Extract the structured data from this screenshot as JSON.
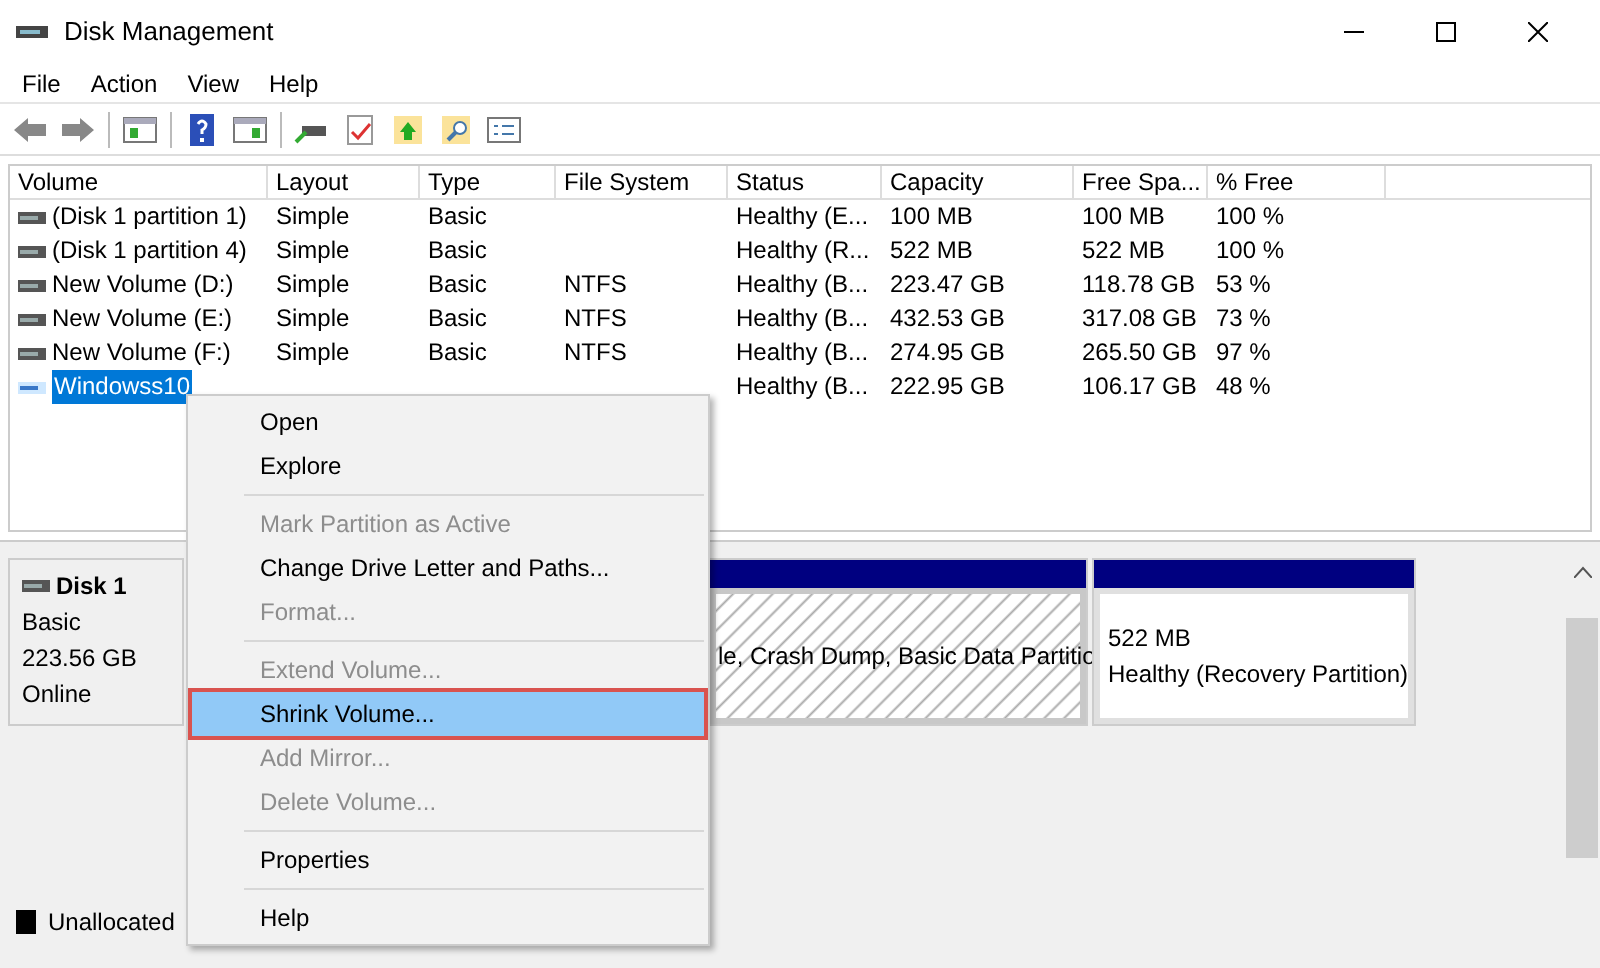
{
  "window": {
    "title": "Disk Management"
  },
  "menu": [
    "File",
    "Action",
    "View",
    "Help"
  ],
  "table": {
    "columns": [
      "Volume",
      "Layout",
      "Type",
      "File System",
      "Status",
      "Capacity",
      "Free Spa...",
      "% Free"
    ],
    "rows": [
      {
        "selected": false,
        "cells": [
          "(Disk 1 partition 1)",
          "Simple",
          "Basic",
          "",
          "Healthy (E...",
          "100 MB",
          "100 MB",
          "100 %"
        ]
      },
      {
        "selected": false,
        "cells": [
          "(Disk 1 partition 4)",
          "Simple",
          "Basic",
          "",
          "Healthy (R...",
          "522 MB",
          "522 MB",
          "100 %"
        ]
      },
      {
        "selected": false,
        "cells": [
          "New Volume (D:)",
          "Simple",
          "Basic",
          "NTFS",
          "Healthy (B...",
          "223.47 GB",
          "118.78 GB",
          "53 %"
        ]
      },
      {
        "selected": false,
        "cells": [
          "New Volume (E:)",
          "Simple",
          "Basic",
          "NTFS",
          "Healthy (B...",
          "432.53 GB",
          "317.08 GB",
          "73 %"
        ]
      },
      {
        "selected": false,
        "cells": [
          "New Volume (F:)",
          "Simple",
          "Basic",
          "NTFS",
          "Healthy (B...",
          "274.95 GB",
          "265.50 GB",
          "97 %"
        ]
      },
      {
        "selected": true,
        "cells": [
          "Windowss10",
          "",
          "",
          "",
          "Healthy (B...",
          "222.95 GB",
          "106.17 GB",
          "48 %"
        ]
      }
    ]
  },
  "disk": {
    "name": "Disk 1",
    "type": "Basic",
    "size": "223.56 GB",
    "status": "Online",
    "partitions": [
      {
        "kind": "hatched",
        "text": "le, Crash Dump, Basic Data Partitio"
      },
      {
        "kind": "plain",
        "size": "522 MB",
        "text": "Healthy (Recovery Partition)"
      }
    ]
  },
  "legend": [
    {
      "label": "Unallocated",
      "color": "#000000"
    }
  ],
  "context_menu": [
    {
      "kind": "item",
      "label": "Open",
      "disabled": false,
      "selected": false
    },
    {
      "kind": "item",
      "label": "Explore",
      "disabled": false,
      "selected": false
    },
    {
      "kind": "separator"
    },
    {
      "kind": "item",
      "label": "Mark Partition as Active",
      "disabled": true,
      "selected": false
    },
    {
      "kind": "item",
      "label": "Change Drive Letter and Paths...",
      "disabled": false,
      "selected": false
    },
    {
      "kind": "item",
      "label": "Format...",
      "disabled": true,
      "selected": false
    },
    {
      "kind": "separator"
    },
    {
      "kind": "item",
      "label": "Extend Volume...",
      "disabled": true,
      "selected": false
    },
    {
      "kind": "item",
      "label": "Shrink Volume...",
      "disabled": false,
      "selected": true
    },
    {
      "kind": "item",
      "label": "Add Mirror...",
      "disabled": true,
      "selected": false
    },
    {
      "kind": "item",
      "label": "Delete Volume...",
      "disabled": true,
      "selected": false
    },
    {
      "kind": "separator"
    },
    {
      "kind": "item",
      "label": "Properties",
      "disabled": false,
      "selected": false
    },
    {
      "kind": "separator"
    },
    {
      "kind": "item",
      "label": "Help",
      "disabled": false,
      "selected": false
    }
  ]
}
